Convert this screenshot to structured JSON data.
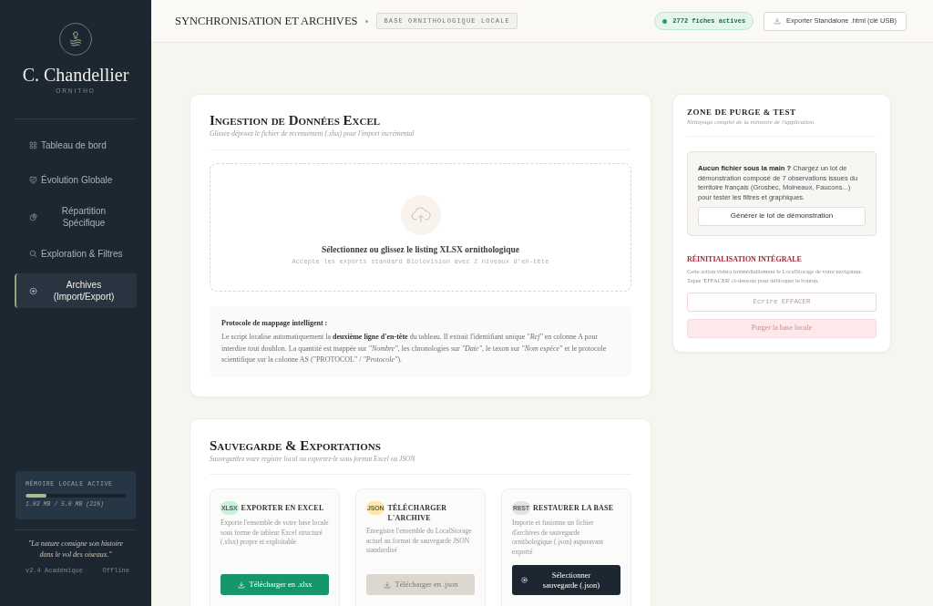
{
  "sidebar": {
    "brand": {
      "name": "C. Chandellier",
      "tagline": "ORNITHO"
    },
    "nav": [
      {
        "label": "Tableau de bord",
        "selected": false
      },
      {
        "label": "Évolution Globale",
        "selected": false
      },
      {
        "label": "Répartition Spécifique",
        "selected": false
      },
      {
        "label": "Exploration & Filtres",
        "selected": false
      },
      {
        "label": "Archives (Import/Export)",
        "selected": true
      }
    ],
    "memory": {
      "label": "MÉMOIRE LOCALE ACTIVE",
      "level": 0.21,
      "reading": "1.03 MB / 5.0 MB (21%)"
    },
    "quote": "\"La nature consigne son histoire dans le vol des oiseaux.\"",
    "version": "v2.4 Académique",
    "connection": "Offline"
  },
  "header": {
    "title": "SYNCHRONISATION ET ARCHIVES",
    "scope": "BASE ORNITHOLOGIQUE LOCALE",
    "record_count": "2772 fiches actives",
    "export_button": "Exporter Standalone .html (clé USB)"
  },
  "ingestion": {
    "title": "Ingestion de Données Excel",
    "subtitle": "Glissez-déposez le fichier de recensement (.xlsx) pour l'import incrémental",
    "dropzone": {
      "prompt": "Sélectionnez ou glissez le listing XLSX ornithologique",
      "hint": "Accepte les exports standard Biolovision avec 2 niveaux d'en-tête"
    },
    "protocol": {
      "title": "Protocole de mappage intelligent :",
      "text": "Le script localise automatiquement la **deuxième ligne d'en-tête** du tableau. Il extrait l'identifiant unique *\"Ref\"* en colonne A pour interdire tout doublon. La quantité est mappée sur *\"Nombre\"*, les chronologies sur *\"Date\"*, le taxon sur *\"Nom espèce\"* et le protocole scientifique sur la colonne AS (\"PROTOCOL\" / *\"Protocole\"*)."
    }
  },
  "purge": {
    "title": "ZONE DE PURGE & TEST",
    "subtitle": "Nettoyage complet de la mémoire de l'application",
    "demo": {
      "text": "**Aucun fichier sous la main ?** Chargez un lot de démonstration composé de 7 observations issues du territoire français (Grosbec, Moineaux, Faucons...) pour tester les filtres et graphiques.",
      "button": "Générer le lot de démonstration"
    },
    "reset": {
      "title": "RÉINITIALISATION INTÉGRALE",
      "text": "Cette action videra irrémédiablement le LocalStorage de votre navigateur. Tapez 'EFFACER' ci-dessous pour débloquer le bouton.",
      "placeholder": "Écrire EFFACER",
      "button": {
        "label": "Purger la base locale",
        "disabled": true
      }
    }
  },
  "backup": {
    "title": "Sauvegarde & Exportations",
    "subtitle": "Sauvegardez votre registre local ou exportez-le sous format Excel ou JSON",
    "cards": [
      {
        "badge": "XLSX",
        "color": "#c9f0dc",
        "title": "EXPORTER EN EXCEL",
        "text": "Exporte l'ensemble de votre base locale sous forme de tableur Excel structuré (.xlsx) propre et exploitable",
        "button": {
          "kind": "download",
          "label": "Télécharger en .xlsx",
          "disabled": false
        }
      },
      {
        "badge": "JSON",
        "color": "#fde6b0",
        "title": "TÉLÉCHARGER L'ARCHIVE",
        "text": "Enregistre l'ensemble du LocalStorage actuel au format de sauvegarde JSON standardisé",
        "button": {
          "kind": "download",
          "label": "Télécharger en .json",
          "disabled": true
        }
      },
      {
        "badge": "REST",
        "color": "#e3e3e3",
        "title": "RESTAURER LA BASE",
        "text": "Importe et fusionne un fichier d'archives de sauvegarde ornithologique (.json) auparavant exporté",
        "button": {
          "kind": "select",
          "label": "Sélectionner sauvegarde (.json)",
          "disabled": false
        }
      }
    ]
  }
}
